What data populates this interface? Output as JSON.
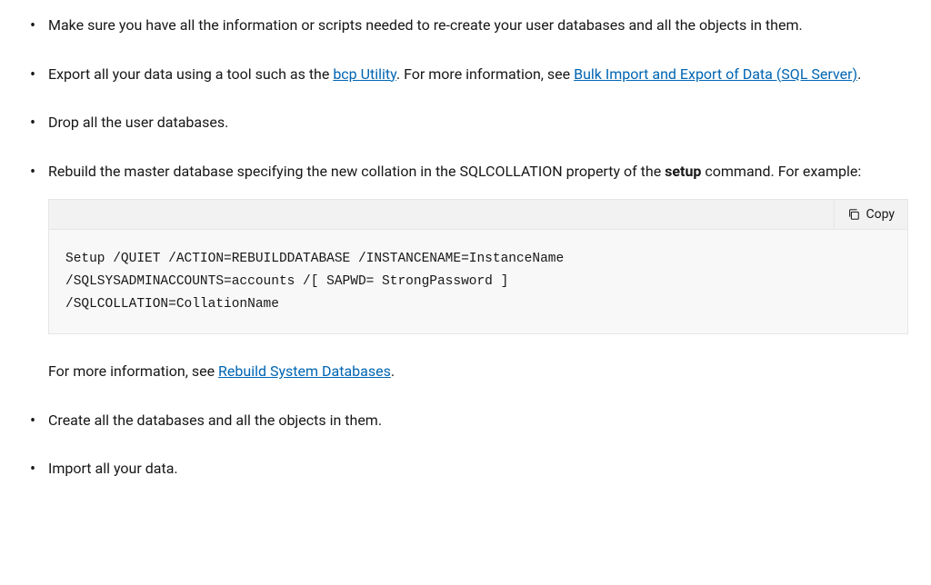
{
  "items": [
    {
      "text": "Make sure you have all the information or scripts needed to re-create your user databases and all the objects in them."
    },
    {
      "prefix": "Export all your data using a tool such as the ",
      "link1": "bcp Utility",
      "mid": ". For more information, see ",
      "link2": "Bulk Import and Export of Data (SQL Server)",
      "suffix": "."
    },
    {
      "text": "Drop all the user databases."
    },
    {
      "prefix": "Rebuild the master database specifying the new collation in the SQLCOLLATION property of the ",
      "strong": "setup",
      "suffix": " command. For example:"
    }
  ],
  "code": {
    "copy_label": "Copy",
    "content": "Setup /QUIET /ACTION=REBUILDDATABASE /INSTANCENAME=InstanceName\n/SQLSYSADMINACCOUNTS=accounts /[ SAPWD= StrongPassword ]\n/SQLCOLLATION=CollationName"
  },
  "after_code": {
    "prefix": "For more information, see ",
    "link": "Rebuild System Databases",
    "suffix": "."
  },
  "items_after": [
    {
      "text": "Create all the databases and all the objects in them."
    },
    {
      "text": "Import all your data."
    }
  ]
}
